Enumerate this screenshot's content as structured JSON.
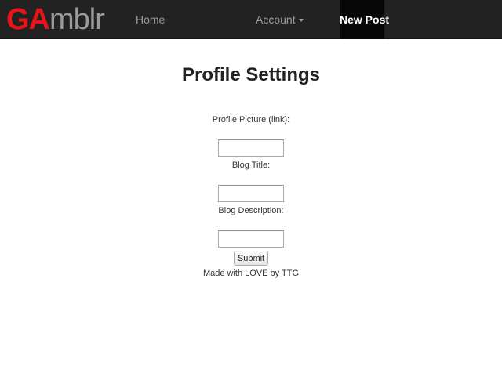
{
  "navbar": {
    "brand_prefix": "GA",
    "brand_suffix": "mblr",
    "home_label": "Home",
    "account_label": "Account",
    "new_post_label": "New Post"
  },
  "page": {
    "title": "Profile Settings"
  },
  "form": {
    "profile_picture_label": "Profile Picture (link):",
    "profile_picture_value": "",
    "blog_title_label": "Blog Title:",
    "blog_title_value": "",
    "blog_description_label": "Blog Description:",
    "blog_description_value": "",
    "submit_label": "Submit"
  },
  "footer": {
    "text": "Made with LOVE by TTG"
  },
  "colors": {
    "navbar_bg": "#222222",
    "brand_red": "#e8141c",
    "brand_gray": "#9a9a9a",
    "active_tab_bg": "#080808"
  }
}
